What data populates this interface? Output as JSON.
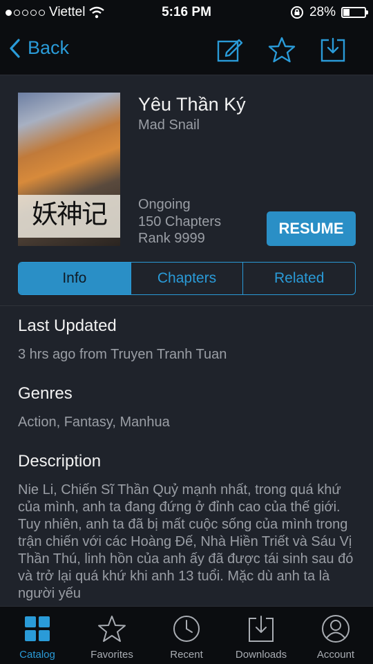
{
  "status_bar": {
    "carrier": "Viettel",
    "time": "5:16 PM",
    "battery_percent": "28%"
  },
  "nav": {
    "back_label": "Back"
  },
  "manga": {
    "title": "Yêu Thần Ký",
    "author": "Mad Snail",
    "status": "Ongoing",
    "chapters": "150 Chapters",
    "rank": "Rank 9999",
    "cover_text": "妖神记"
  },
  "resume_label": "RESUME",
  "segments": {
    "info": "Info",
    "chapters": "Chapters",
    "related": "Related",
    "active": "Info"
  },
  "last_updated": {
    "heading": "Last Updated",
    "value": "3 hrs ago from Truyen Tranh Tuan"
  },
  "genres": {
    "heading": "Genres",
    "value": "Action, Fantasy, Manhua"
  },
  "description": {
    "heading": "Description",
    "text": "Nie Li, Chiến Sĩ Thần Quỷ mạnh nhất, trong quá khứ của mình, anh ta đang đứng ở đỉnh cao của thế giới. Tuy nhiên, anh ta đã bị mất cuộc sống của mình trong trận chiến với các Hoàng Đế, Nhà Hiền Triết và Sáu Vị Thần Thú, linh hồn của anh ấy đã được tái sinh sau đó và trở lại quá khứ khi anh 13 tuổi. Mặc dù anh ta là người yếu"
  },
  "tabs": {
    "catalog": "Catalog",
    "favorites": "Favorites",
    "recent": "Recent",
    "downloads": "Downloads",
    "account": "Account",
    "active": "Catalog"
  },
  "colors": {
    "accent": "#2a9bd8",
    "background": "#1f232b",
    "bar": "#0b0d10",
    "secondary_text": "#9a9ea5"
  }
}
